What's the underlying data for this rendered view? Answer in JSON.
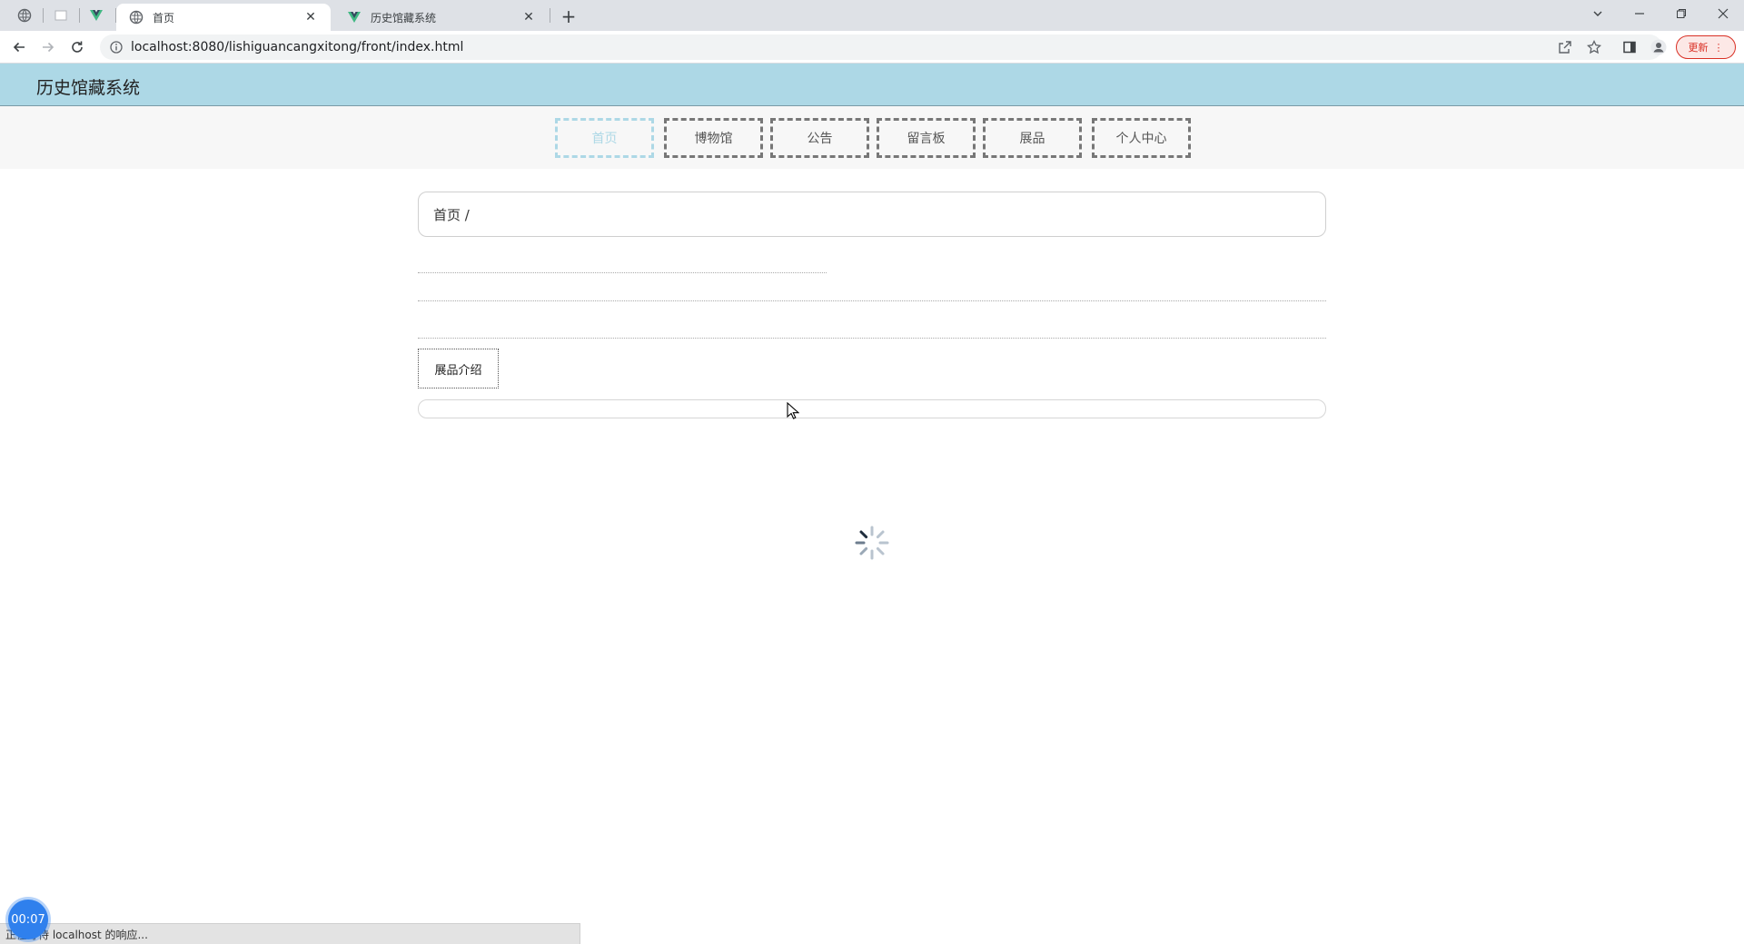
{
  "browser": {
    "tabs": [
      {
        "title": "首页",
        "active": true
      },
      {
        "title": "历史馆藏系统",
        "active": false
      }
    ],
    "new_tab_label": "+",
    "url": "localhost:8080/lishiguancangxitong/front/index.html",
    "update_label": "更新"
  },
  "site": {
    "title": "历史馆藏系统",
    "nav": [
      {
        "label": "首页",
        "active": true
      },
      {
        "label": "博物馆",
        "active": false
      },
      {
        "label": "公告",
        "active": false
      },
      {
        "label": "留言板",
        "active": false
      },
      {
        "label": "展品",
        "active": false
      },
      {
        "label": "个人中心",
        "active": false
      }
    ],
    "breadcrumb": "首页 /",
    "intro_button": "展品介绍"
  },
  "status": {
    "text": "正在等待 localhost 的响应...",
    "timer": "00:07"
  },
  "colors": {
    "header_bg": "#add8e6",
    "active_nav": "#add8e6",
    "timer_bg": "#2f80ed"
  }
}
